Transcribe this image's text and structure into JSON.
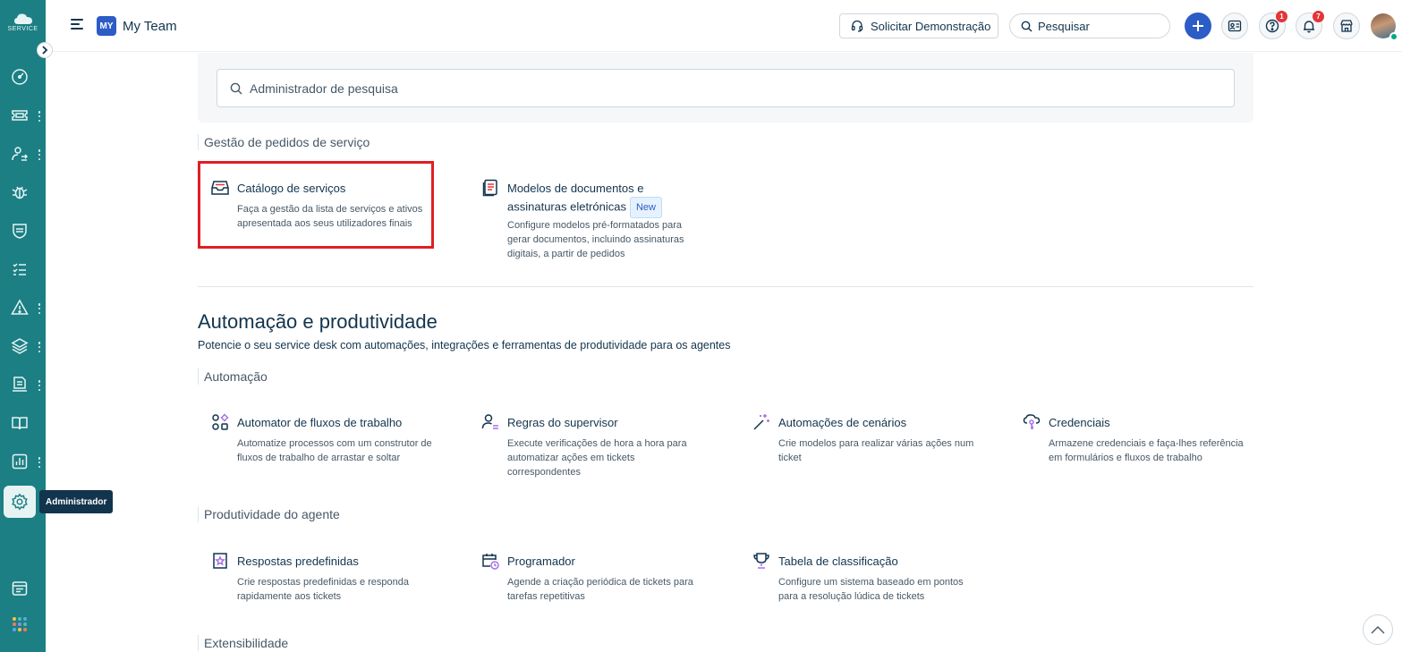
{
  "sidebar": {
    "logo_text": "SERVICE",
    "tooltip": "Administrador",
    "items": [
      {
        "icon": "dashboard-icon"
      },
      {
        "icon": "tickets-icon"
      },
      {
        "icon": "contacts-icon"
      },
      {
        "icon": "problems-icon"
      },
      {
        "icon": "changes-icon"
      },
      {
        "icon": "tasks-icon"
      },
      {
        "icon": "alerts-icon"
      },
      {
        "icon": "assets-icon"
      },
      {
        "icon": "releases-icon"
      },
      {
        "icon": "solutions-icon"
      },
      {
        "icon": "reports-icon"
      },
      {
        "icon": "admin-gear-icon"
      },
      {
        "icon": "catalog-icon"
      }
    ]
  },
  "header": {
    "workspace_badge": "MY",
    "workspace_name": "My Team",
    "demo_button": "Solicitar Demonstração",
    "search_placeholder": "Pesquisar",
    "help_count": "1",
    "notification_count": "7"
  },
  "admin_search": {
    "placeholder": "Administrador de pesquisa"
  },
  "service_requests": {
    "heading": "Gestão de pedidos de serviço",
    "cards": [
      {
        "title": "Catálogo de serviços",
        "desc": "Faça a gestão da lista de serviços e ativos apresentada aos seus utilizadores finais"
      },
      {
        "title": "Modelos de documentos e assinaturas eletrónicas",
        "badge": "New",
        "desc": "Configure modelos pré-formatados para gerar documentos, incluindo assinaturas digitais, a partir de pedidos"
      }
    ]
  },
  "automation_section": {
    "title": "Automação e produtividade",
    "description": "Potencie o seu service desk com automações, integrações e ferramentas de produtividade para os agentes",
    "automation_heading": "Automação",
    "automation_cards": [
      {
        "title": "Automator de fluxos de trabalho",
        "desc": "Automatize processos com um construtor de fluxos de trabalho de arrastar e soltar"
      },
      {
        "title": "Regras do supervisor",
        "desc": "Execute verificações de hora a hora para automatizar ações em tickets correspondentes"
      },
      {
        "title": "Automações de cenários",
        "desc": "Crie modelos para realizar várias ações num ticket"
      },
      {
        "title": "Credenciais",
        "desc": "Armazene credenciais e faça-lhes referência em formulários e fluxos de trabalho"
      }
    ],
    "productivity_heading": "Produtividade do agente",
    "productivity_cards": [
      {
        "title": "Respostas predefinidas",
        "desc": "Crie respostas predefinidas e responda rapidamente aos tickets"
      },
      {
        "title": "Programador",
        "desc": "Agende a criação periódica de tickets para tarefas repetitivas"
      },
      {
        "title": "Tabela de classificação",
        "desc": "Configure um sistema baseado em pontos para a resolução lúdica de tickets"
      }
    ],
    "extensibility_heading": "Extensibilidade"
  },
  "colors": {
    "sidebar": "#1b7f84",
    "primary": "#2c5cc5",
    "highlight": "#e01e24",
    "badge": "#e43538"
  }
}
